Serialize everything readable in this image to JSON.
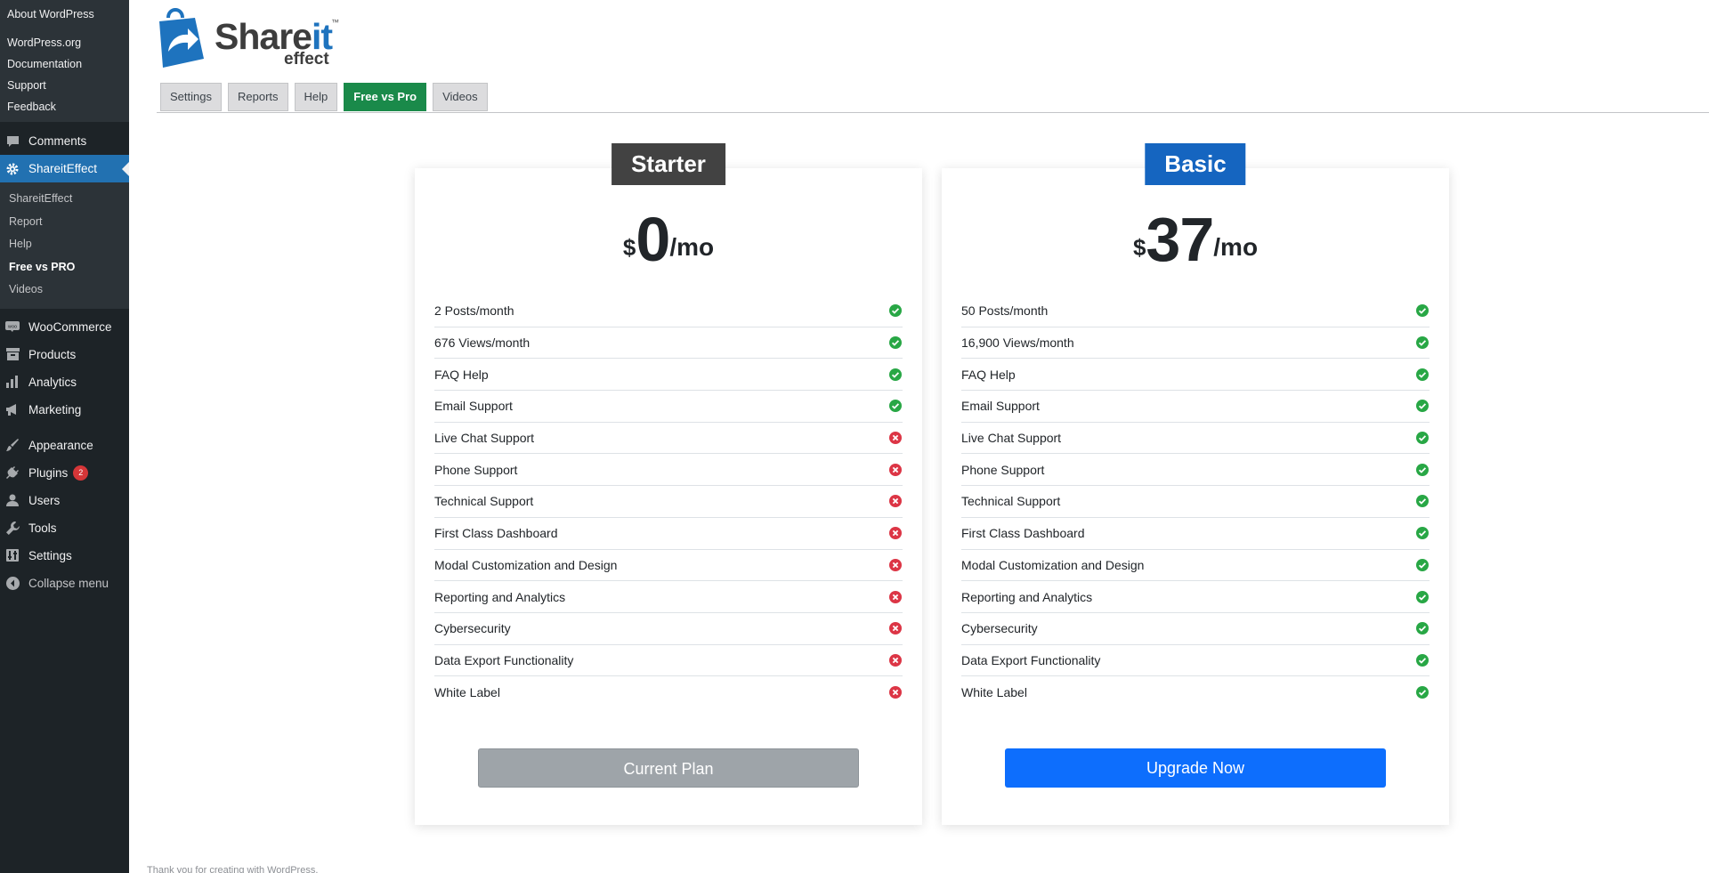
{
  "sidebar": {
    "about": "About WordPress",
    "wp_links": [
      "WordPress.org",
      "Documentation",
      "Support",
      "Feedback"
    ],
    "comments": "Comments",
    "active_plugin": "ShareitEffect",
    "submenu": [
      "ShareitEffect",
      "Report",
      "Help",
      "Free vs PRO",
      "Videos"
    ],
    "woocommerce": "WooCommerce",
    "products": "Products",
    "analytics": "Analytics",
    "marketing": "Marketing",
    "appearance": "Appearance",
    "plugins": "Plugins",
    "plugins_badge": "2",
    "users": "Users",
    "tools": "Tools",
    "settings": "Settings",
    "collapse": "Collapse menu"
  },
  "logo": {
    "word_main": "Share",
    "word_accent": "it",
    "tm": "™",
    "sub": "effect"
  },
  "tabs": [
    "Settings",
    "Reports",
    "Help",
    "Free vs Pro",
    "Videos"
  ],
  "active_tab": "Free vs Pro",
  "plans": [
    {
      "name": "Starter",
      "currency": "$",
      "amount": "0",
      "period": "/mo",
      "button": "Current Plan",
      "features": [
        {
          "label": "2 Posts/month",
          "included": true
        },
        {
          "label": "676 Views/month",
          "included": true
        },
        {
          "label": "FAQ Help",
          "included": true
        },
        {
          "label": "Email Support",
          "included": true
        },
        {
          "label": "Live Chat Support",
          "included": false
        },
        {
          "label": "Phone Support",
          "included": false
        },
        {
          "label": "Technical Support",
          "included": false
        },
        {
          "label": "First Class Dashboard",
          "included": false
        },
        {
          "label": "Modal Customization and Design",
          "included": false
        },
        {
          "label": "Reporting and Analytics",
          "included": false
        },
        {
          "label": "Cybersecurity",
          "included": false
        },
        {
          "label": "Data Export Functionality",
          "included": false
        },
        {
          "label": "White Label",
          "included": false
        }
      ]
    },
    {
      "name": "Basic",
      "currency": "$",
      "amount": "37",
      "period": "/mo",
      "button": "Upgrade Now",
      "features": [
        {
          "label": "50 Posts/month",
          "included": true
        },
        {
          "label": "16,900 Views/month",
          "included": true
        },
        {
          "label": "FAQ Help",
          "included": true
        },
        {
          "label": "Email Support",
          "included": true
        },
        {
          "label": "Live Chat Support",
          "included": true
        },
        {
          "label": "Phone Support",
          "included": true
        },
        {
          "label": "Technical Support",
          "included": true
        },
        {
          "label": "First Class Dashboard",
          "included": true
        },
        {
          "label": "Modal Customization and Design",
          "included": true
        },
        {
          "label": "Reporting and Analytics",
          "included": true
        },
        {
          "label": "Cybersecurity",
          "included": true
        },
        {
          "label": "Data Export Functionality",
          "included": true
        },
        {
          "label": "White Label",
          "included": true
        }
      ]
    }
  ],
  "footer": "Thank you for creating with WordPress.",
  "colors": {
    "sidebar_bg": "#1d2327",
    "active_menu": "#2271b1",
    "active_tab": "#1a8a4a",
    "starter_label": "#424242",
    "basic_label": "#1565c0",
    "check": "#28a745",
    "cross": "#dc3545",
    "upgrade_button": "#0d6efd"
  },
  "icons": {
    "included": "check-circle-icon",
    "excluded": "x-circle-icon"
  }
}
